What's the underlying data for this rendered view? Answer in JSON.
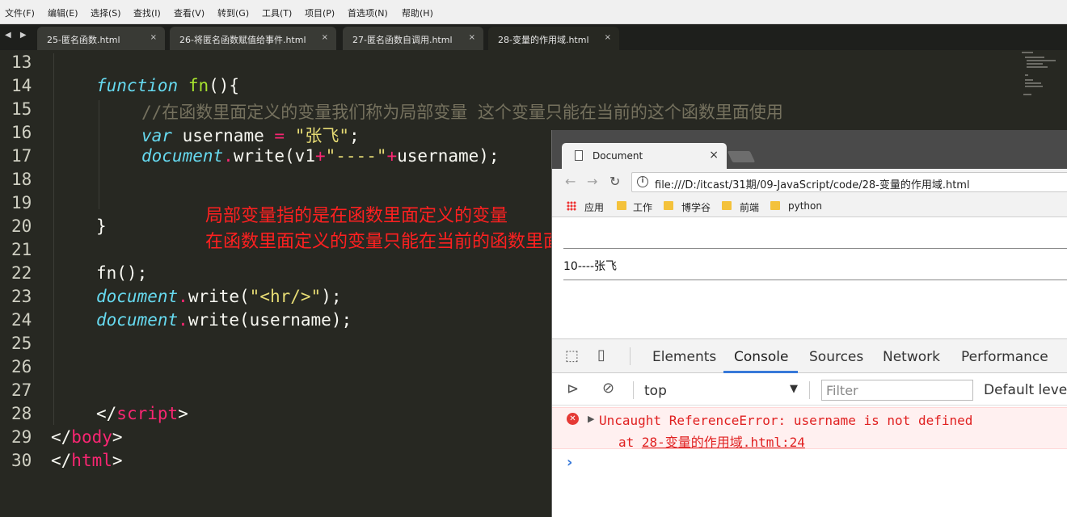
{
  "menubar": {
    "items": [
      "文件(F)",
      "编辑(E)",
      "选择(S)",
      "查找(I)",
      "查看(V)",
      "转到(G)",
      "工具(T)",
      "项目(P)",
      "首选项(N)",
      "帮助(H)"
    ]
  },
  "editor_tabs": [
    {
      "label": "25-匿名函数.html",
      "close": "×"
    },
    {
      "label": "26-将匿名函数赋值给事件.html",
      "close": "×"
    },
    {
      "label": "27-匿名函数自调用.html",
      "close": "×"
    },
    {
      "label": "28-变量的作用域.html",
      "close": "×"
    }
  ],
  "tab_nav": "◀ ▶",
  "line_numbers": [
    "13",
    "14",
    "15",
    "16",
    "17",
    "18",
    "19",
    "20",
    "21",
    "22",
    "23",
    "24",
    "25",
    "26",
    "27",
    "28",
    "29",
    "30"
  ],
  "code": {
    "l14": {
      "kw": "function",
      "name": "fn",
      "rest": "(){"
    },
    "l15": "//在函数里面定义的变量我们称为局部变量 这个变量只能在当前的这个函数里面使用",
    "l16": {
      "kw": "var",
      "mid": " username ",
      "eq": "=",
      "str": "\"张飞\"",
      "end": ";"
    },
    "l17": {
      "obj": "document",
      "dot": ".",
      "call": "write(v1",
      "plus1": "+",
      "str": "\"----\"",
      "plus2": "+",
      "end": "username);"
    },
    "l20": "}",
    "l22": "fn();",
    "l23": {
      "obj": "document",
      "dot": ".",
      "call": "write(",
      "str": "\"<hr/>\"",
      "end": ");"
    },
    "l24": {
      "obj": "document",
      "dot": ".",
      "call": "write(username);"
    },
    "l28": {
      "open": "</",
      "tag": "script",
      "close": ">"
    },
    "l29": {
      "open": "</",
      "tag": "body",
      "close": ">"
    },
    "l30": {
      "open": "</",
      "tag": "html",
      "close": ">"
    }
  },
  "annotation": {
    "line1": "局部变量指的是在函数里面定义的变量",
    "line2": "在函数里面定义的变量只能在当前的函数里面起作用"
  },
  "browser": {
    "tab_title": "Document",
    "tab_close": "×",
    "url": "file:///D:/itcast/31期/09-JavaScript/code/28-变量的作用域.html",
    "info_glyph": "i",
    "bookmarks": [
      "应用",
      "工作",
      "博学谷",
      "前端",
      "python"
    ],
    "page_output": "10----张飞"
  },
  "devtools": {
    "tabs": [
      "Elements",
      "Console",
      "Sources",
      "Network",
      "Performance"
    ],
    "active_tab": "Console",
    "context": "top",
    "filter_placeholder": "Filter",
    "levels": "Default levels",
    "error_message": "Uncaught ReferenceError: username is not defined",
    "error_stack_prefix": "at ",
    "error_stack_link": "28-变量的作用域.html:24",
    "prompt": "›"
  },
  "colors": {
    "editor_bg": "#272822",
    "keyword": "#66d9ef",
    "string": "#e6db74",
    "operator": "#f92672",
    "comment": "#75715e",
    "annotation": "#ff2020",
    "error": "#e02020",
    "devtools_accent": "#3879d9"
  }
}
